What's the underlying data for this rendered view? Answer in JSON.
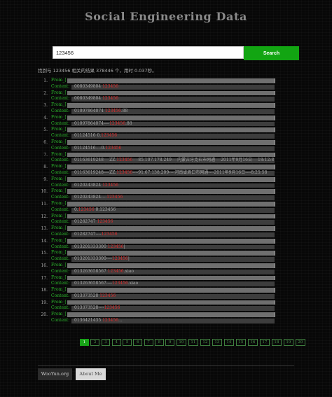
{
  "header": {
    "title": "Social Engineering Data"
  },
  "search": {
    "value": "123456",
    "button_label": "Search"
  },
  "summary": "找到与 123456 相关的结果 378446 个，用时 0.037秒。",
  "labels": {
    "from": "From_[",
    "content": "Content:"
  },
  "results": [
    {
      "num": "1.",
      "content_pre": "0080349804 ",
      "content_hl": "123456",
      "content_post": ""
    },
    {
      "num": "2.",
      "content_pre": "0080349804 ",
      "content_hl": "123456",
      "content_post": ""
    },
    {
      "num": "3.",
      "content_pre": "01097864074 ",
      "content_hl": "123456",
      "content_post": ".88"
    },
    {
      "num": "4.",
      "content_pre": "01097864074----",
      "content_hl": "123456",
      "content_post": ".88"
    },
    {
      "num": "5.",
      "content_pre": "01124516 0.",
      "content_hl": "123456",
      "content_post": ""
    },
    {
      "num": "6.",
      "content_pre": "01124516----0.",
      "content_hl": "123456",
      "content_post": ""
    },
    {
      "num": "7.",
      "content_pre": "01163619248----ZZ.",
      "content_hl": "123456",
      "content_post": "----85.107.178.249----内蒙古牙克石市网通----2011年9月16日----18:12:8"
    },
    {
      "num": "8.",
      "content_pre": "01163619248----ZZ.",
      "content_hl": "123456",
      "content_post": "----91.67.138.209----河南省周口市网通----2011年9月16日----8:25:58"
    },
    {
      "num": "9.",
      "content_pre": "0120243824 ",
      "content_hl": "123456",
      "content_post": ""
    },
    {
      "num": "10.",
      "content_pre": "0120243824----",
      "content_hl": "123456",
      "content_post": ""
    },
    {
      "num": "11.",
      "content_pre": "0.",
      "content_hl": "123456",
      "content_post": " 0.123456"
    },
    {
      "num": "12.",
      "content_pre": "01282747 ",
      "content_hl": "123456",
      "content_post": ""
    },
    {
      "num": "13.",
      "content_pre": "01282747----",
      "content_hl": "123456",
      "content_post": ""
    },
    {
      "num": "14.",
      "content_pre": "013201333300 ",
      "content_hl": "123456",
      "content_post": "|"
    },
    {
      "num": "15.",
      "content_pre": "013201333300----",
      "content_hl": "123456",
      "content_post": "|"
    },
    {
      "num": "16.",
      "content_pre": "013263658567 ",
      "content_hl": "123456",
      "content_post": ".xiao"
    },
    {
      "num": "17.",
      "content_pre": "013263658567----",
      "content_hl": "123456",
      "content_post": ".xiao"
    },
    {
      "num": "18.",
      "content_pre": "013373528 ",
      "content_hl": "123456",
      "content_post": ""
    },
    {
      "num": "19.",
      "content_pre": "013373528----",
      "content_hl": "123456",
      "content_post": ""
    },
    {
      "num": "20.",
      "content_pre": "0136421435 ",
      "content_hl": "123456",
      "content_post": "..."
    }
  ],
  "pagination": {
    "current": "1",
    "pages": [
      "1",
      "2",
      "3",
      "4",
      "5",
      "6",
      "7",
      "8",
      "9",
      "10",
      "11",
      "12",
      "13",
      "14",
      "15",
      "16",
      "17",
      "18",
      "19",
      "20"
    ]
  },
  "footer": {
    "tabs": [
      "WooYun.org",
      "About Me"
    ]
  },
  "colors": {
    "accent": "#12a512",
    "highlight": "#e22b2b",
    "label": "#2dbd2d"
  }
}
